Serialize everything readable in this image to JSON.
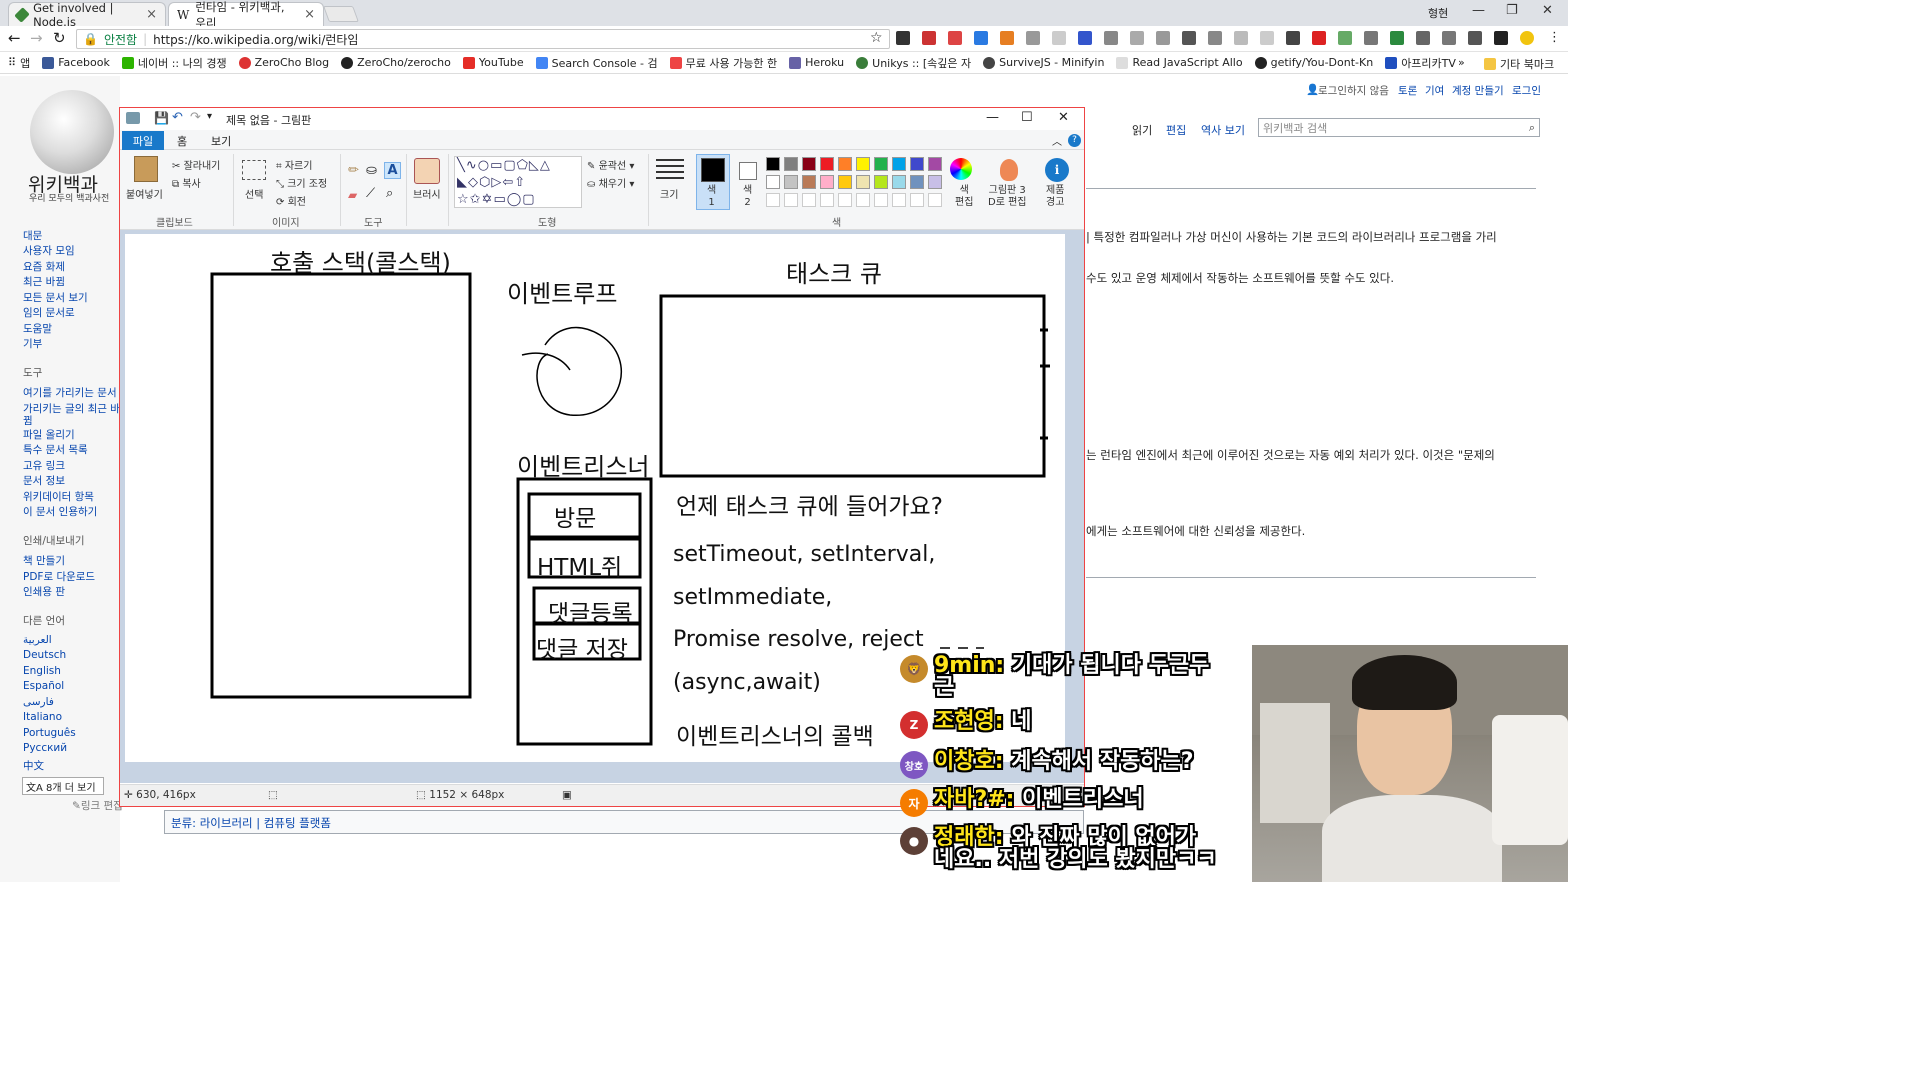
{
  "browser": {
    "tabs": [
      {
        "title": "Get involved | Node.js",
        "color": "#3c873a"
      },
      {
        "title": "런타임 - 위키백과, 우리",
        "color": "#222222"
      }
    ],
    "profile": "형현",
    "url": "https://ko.wikipedia.org/wiki/런타임",
    "secure_label": "안전함",
    "apps_label": "앱",
    "bookmarks": [
      {
        "label": "Facebook",
        "color": "#3b5998"
      },
      {
        "label": "네이버 :: 나의 경쟁",
        "color": "#2db400"
      },
      {
        "label": "ZeroCho Blog",
        "color": "#d33"
      },
      {
        "label": "ZeroCho/zerocho",
        "color": "#222"
      },
      {
        "label": "YouTube",
        "color": "#e52d27"
      },
      {
        "label": "Search Console - 검",
        "color": "#4285f4"
      },
      {
        "label": "무료 사용 가능한 한",
        "color": "#e44"
      },
      {
        "label": "Heroku",
        "color": "#6762a6"
      },
      {
        "label": "Unikys :: [속깊은 자",
        "color": "#3a7d3a"
      },
      {
        "label": "SurviveJS - Minifyin",
        "color": "#444"
      },
      {
        "label": "Read JavaScript Allo",
        "color": "#aaa"
      },
      {
        "label": "getify/You-Dont-Kn",
        "color": "#222"
      },
      {
        "label": "아프리카TV",
        "color": "#1f4fbf"
      }
    ],
    "bookmarks_more": "»",
    "other_bookmarks": "기타 북마크"
  },
  "wiki": {
    "logo_title": "위키백과",
    "logo_subtitle": "우리 모두의 백과사전",
    "nav": [
      "대문",
      "사용자 모임",
      "요즘 화제",
      "최근 바뀜",
      "모든 문서 보기",
      "임의 문서로",
      "도움말",
      "기부"
    ],
    "tools_heading": "도구",
    "tools": [
      "여기를 가리키는 문서",
      "가리키는 글의 최근 바",
      "뀜",
      "파일 올리기",
      "특수 문서 목록",
      "고유 링크",
      "문서 정보",
      "위키데이터 항목",
      "이 문서 인용하기"
    ],
    "print_heading": "인쇄/내보내기",
    "print": [
      "책 만들기",
      "PDF로 다운로드",
      "인쇄용 판"
    ],
    "lang_heading": "다른 언어",
    "languages": [
      "العربية",
      "Deutsch",
      "English",
      "Español",
      "فارسی",
      "Italiano",
      "Português",
      "Русский",
      "中文"
    ],
    "more_languages": "8개 더 보기",
    "edit_links": "링크 편집",
    "top_links": {
      "not_logged_in": "로그인하지 않음",
      "talk": "토론",
      "contrib": "기여",
      "create_account": "계정 만들기",
      "login": "로그인"
    },
    "view_tabs": [
      "읽기",
      "편집",
      "역사 보기"
    ],
    "search_placeholder": "위키백과 검색",
    "text_lines": [
      "| 특정한 컴파일러나 가상 머신이 사용하는 기본 코드의 라이브러리나 프로그램을 가리",
      "수도 있고 운영 체제에서 작동하는 소프트웨어를 뜻할 수도 있다.",
      "는 런타임 엔진에서 최근에 이루어진 것으로는 자동 예외 처리가 있다. 이것은 \"문제의",
      "에게는 소프트웨어에 대한 신뢰성을 제공한다."
    ],
    "category_label": "분류:",
    "categories": "라이브러리 | 컴퓨팅 플랫폼"
  },
  "paint": {
    "title": "제목 없음 - 그림판",
    "tabs": {
      "file": "파일",
      "home": "홈",
      "view": "보기"
    },
    "clipboard": {
      "paste": "붙여넣기",
      "cut": "잘라내기",
      "copy": "복사",
      "group": "클립보드"
    },
    "image": {
      "select": "선택",
      "crop": "자르기",
      "resize": "크기 조정",
      "rotate": "회전",
      "group": "이미지"
    },
    "tools_group": "도구",
    "brush": "브러시",
    "shapes": {
      "outline": "윤곽선",
      "fill": "채우기",
      "group": "도형"
    },
    "size": "크기",
    "color1": "색\n1",
    "color2": "색\n2",
    "edit_colors": "색\n편집",
    "paint3d": "그림판 3\nD로 편집",
    "product_alert": "제품\n경고",
    "colors_group": "색",
    "palette": [
      "#000000",
      "#7f7f7f",
      "#880015",
      "#ed1c24",
      "#ff7f27",
      "#fff200",
      "#22b14c",
      "#00a2e8",
      "#3f48cc",
      "#a349a4",
      "#ffffff",
      "#c3c3c3",
      "#b97a57",
      "#ffaec9",
      "#ffc90e",
      "#efe4b0",
      "#b5e61d",
      "#99d9ea",
      "#7092be",
      "#c8bfe7"
    ],
    "status": {
      "cursor": "630, 416px",
      "size": "1152 × 648px"
    },
    "drawing": {
      "call_stack": "호출 스택(콜스택)",
      "event_loop": "이벤트루프",
      "task_queue": "태스크 큐",
      "event_listener": "이벤트리스너",
      "stack_items": [
        "방문",
        "HTML쥐",
        "댓글등록",
        "댓글 저장"
      ],
      "question": "언제 태스크 큐에 들어가요?",
      "apis": [
        "setTimeout, setInterval,",
        "setImmediate,",
        "Promise resolve, reject",
        "(async,await)"
      ],
      "listener_callback": "이벤트리스너의 콜백"
    }
  },
  "chat": [
    {
      "name": "9min:",
      "message": "기대가 됩니다 두근두\n근",
      "avatar": "🦁",
      "color": "#c58a2b"
    },
    {
      "name": "조현영:",
      "message": "네",
      "avatar": "Z",
      "color": "#d32f2f"
    },
    {
      "name": "이창호:",
      "message": "계속해서 작동하는?",
      "avatar": "창호",
      "color": "#7e57c2"
    },
    {
      "name": "자바?#:",
      "message": "이벤트리스너",
      "avatar": "자",
      "color": "#f57c00"
    },
    {
      "name": "정래한:",
      "message": "와 진짜 많이 없어가\n네요.. 저번 강의도 봤지만ㅋㅋ",
      "avatar": "●",
      "color": "#5d4037"
    }
  ]
}
